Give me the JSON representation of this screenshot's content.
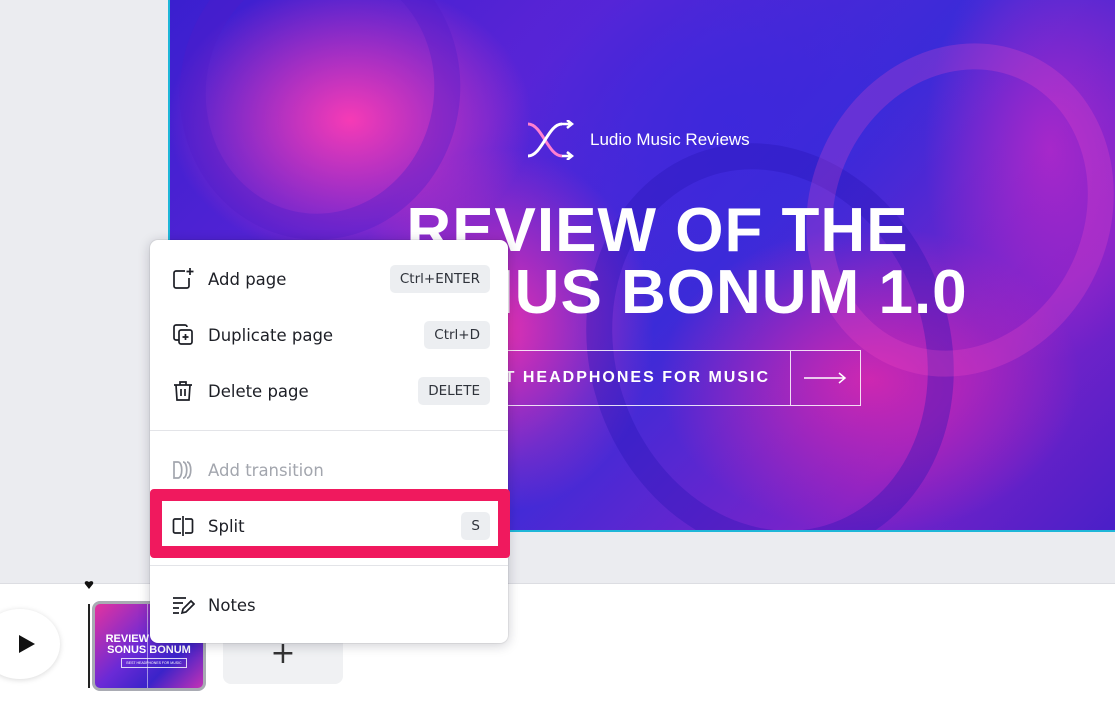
{
  "slide": {
    "brand_name": "Ludio Music Reviews",
    "headline_line1": "REVIEW OF THE",
    "headline_line2": "SONUS BONUM 1.0",
    "cta_text": "BEST HEADPHONES FOR MUSIC"
  },
  "context_menu": {
    "items": [
      {
        "label": "Add page",
        "shortcut": "Ctrl+ENTER",
        "icon": "add-page-icon"
      },
      {
        "label": "Duplicate page",
        "shortcut": "Ctrl+D",
        "icon": "duplicate-icon"
      },
      {
        "label": "Delete page",
        "shortcut": "DELETE",
        "icon": "trash-icon"
      },
      {
        "label": "Add transition",
        "shortcut": "",
        "icon": "transition-icon",
        "disabled": true
      },
      {
        "label": "Split",
        "shortcut": "S",
        "icon": "split-icon",
        "highlighted": true
      },
      {
        "label": "Notes",
        "shortcut": "",
        "icon": "notes-icon"
      }
    ]
  },
  "timeline": {
    "thumbnail_title_line1": "REVIEW OF THE",
    "thumbnail_title_line2": "SONUS BONUM",
    "thumbnail_cta": "BEST HEADPHONES FOR MUSIC",
    "add_page_symbol": "+"
  },
  "colors": {
    "highlight": "#f0195e",
    "canvas_border": "#1fb6d8"
  }
}
